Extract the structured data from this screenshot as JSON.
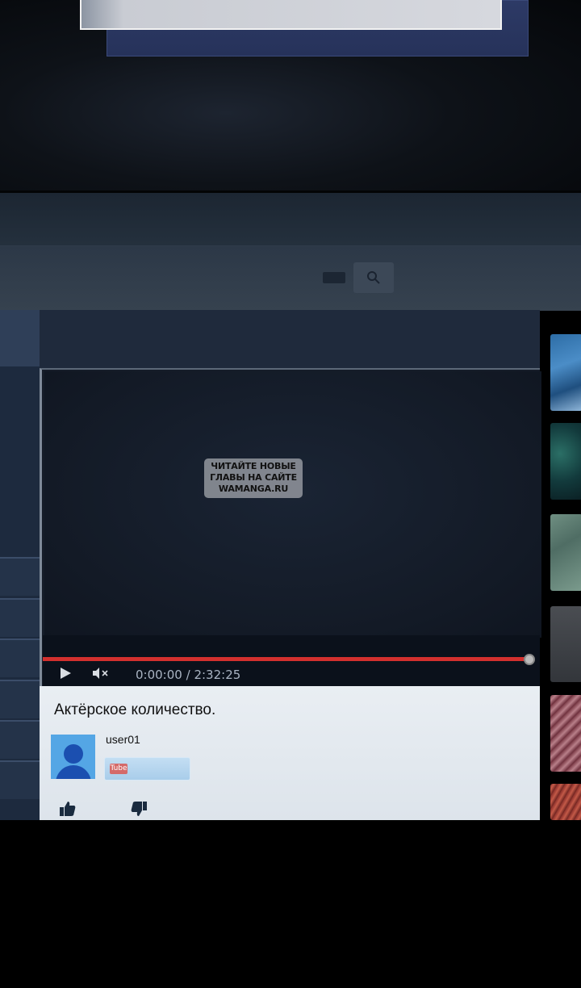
{
  "video": {
    "watermark_lines": [
      "ЧИТАЙТЕ НОВЫЕ",
      "ГЛАВЫ НА САЙТЕ",
      "WAMANGA.RU"
    ],
    "current_time": "0:00:00",
    "separator": "/",
    "duration": "2:32:25",
    "progress_fraction": 1.0,
    "mute_label": "◀×"
  },
  "info": {
    "title": "Актёрское количество.",
    "username": "user01",
    "subscribe_badge": "Tube"
  },
  "colors": {
    "progress": "#d3302e",
    "avatar_bg": "#54a6e5"
  },
  "icons": [
    "search-icon",
    "keyboard-icon",
    "play-icon",
    "mute-icon",
    "like-icon",
    "dislike-icon",
    "avatar-icon"
  ]
}
